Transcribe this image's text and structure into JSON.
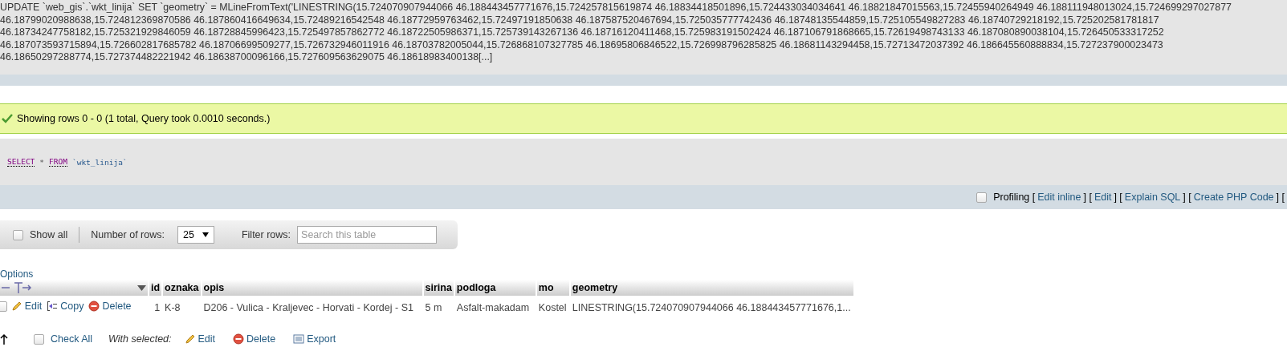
{
  "query": {
    "text": "UPDATE `web_gis`.`wkt_linija` SET `geometry` = MLineFromText('LINESTRING(15.724070907944066 46.188443457771676,15.724257815619874 46.18834418501896,15.724433034034641 46.18821847015563,15.72455940264949 46.188111948013024,15.724699297027877 46.18799020988638,15.724812369870586 46.187860416649634,15.72489216542548 46.18772959763462,15.72497191850638 46.187587520467694,15.725035777742436 46.18748135544859,15.725105549827283 46.18740729218192,15.725202581781817 46.18734247758182,15.725321929846059 46.18728845996423,15.725497857862772 46.18722505986371,15.725739143267136 46.18716120411468,15.725983191502424 46.187106791868665,15.72619498743133 46.187080890038104,15.726450533317252 46.187073593715894,15.726602817685782 46.18706699509277,15.726732946011916 46.18703782005044,15.726868107327785 46.18695806846522,15.726998796285825 46.18681143294458,15.72713472037392 46.186645560888834,15.727237900023473 46.18650297288774,15.727374482221942 46.18638700096166,15.727609563629075 46.18618983400138[...]"
  },
  "message": {
    "text": "Showing rows 0 - 0 (1 total, Query took 0.0010 seconds.)"
  },
  "sql": {
    "tokens": [
      {
        "kind": "keyword",
        "text": "SELECT"
      },
      {
        "kind": "operator",
        "text": "*"
      },
      {
        "kind": "keyword",
        "text": "FROM"
      },
      {
        "kind": "identifier",
        "text": "`wkt_linija`"
      }
    ]
  },
  "profiling": {
    "checked": false,
    "segments": [
      {
        "kind": "text",
        "text": "Profiling ["
      },
      {
        "kind": "link",
        "text": "Edit inline"
      },
      {
        "kind": "text",
        "text": "] ["
      },
      {
        "kind": "link",
        "text": "Edit"
      },
      {
        "kind": "text",
        "text": "] ["
      },
      {
        "kind": "link",
        "text": "Explain SQL"
      },
      {
        "kind": "text",
        "text": "] ["
      },
      {
        "kind": "link",
        "text": "Create PHP Code"
      },
      {
        "kind": "text",
        "text": "] ["
      }
    ]
  },
  "navigation": {
    "show_all": {
      "label": "Show all",
      "checked": false
    },
    "rows_label": "Number of rows:",
    "rows_value": "25",
    "filter_label": "Filter rows:",
    "filter_placeholder": "Search this table"
  },
  "options_link": "Options",
  "table": {
    "columns": [
      "id",
      "oznaka",
      "opis",
      "sirina",
      "podloga",
      "mo",
      "geometry"
    ],
    "rows": [
      {
        "checked": false,
        "actions": [
          {
            "kind": "edit",
            "label": "Edit"
          },
          {
            "kind": "copy",
            "label": "Copy"
          },
          {
            "kind": "delete",
            "label": "Delete"
          }
        ],
        "cells": [
          "1",
          "K-8",
          "D206 - Vulica - Kraljevec - Horvati - Kordej - S1",
          "5 m",
          "Asfalt-makadam",
          "Kostel",
          "LINESTRING(15.724070907944066 46.188443457771676,1..."
        ]
      }
    ]
  },
  "footer": {
    "check_all": {
      "label": "Check All",
      "checked": false
    },
    "with_selected": "With selected:",
    "actions": [
      {
        "kind": "edit",
        "label": "Edit"
      },
      {
        "kind": "delete",
        "label": "Delete"
      },
      {
        "kind": "export",
        "label": "Export"
      }
    ]
  }
}
